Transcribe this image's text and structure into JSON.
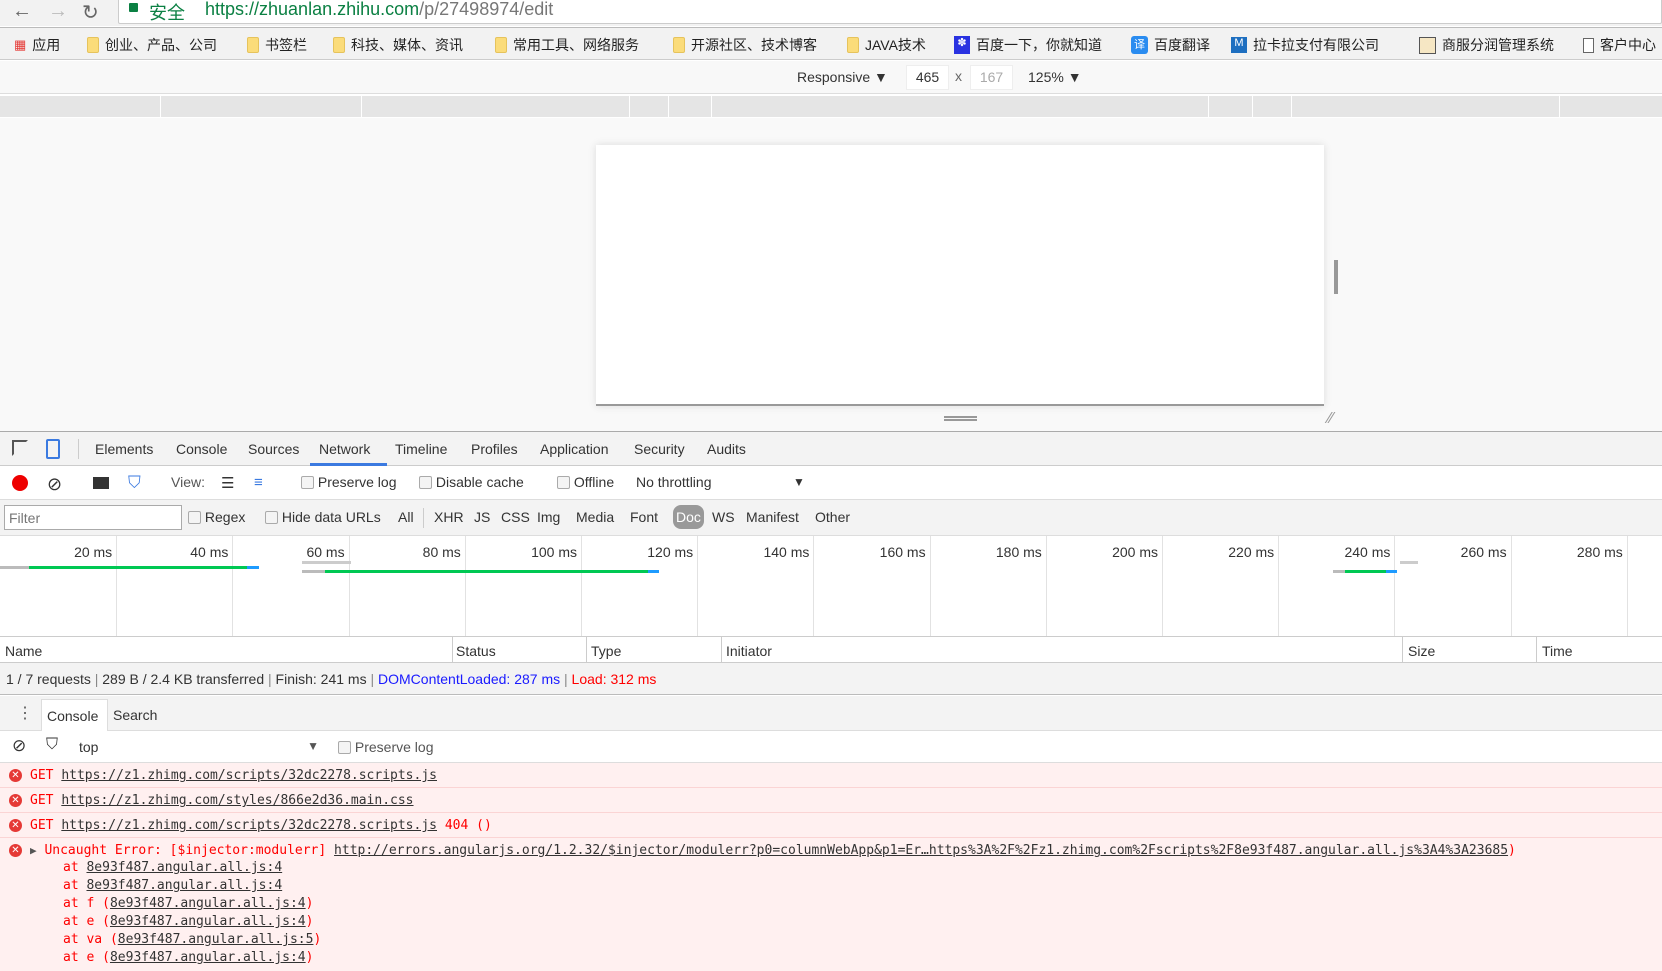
{
  "browser": {
    "security_label": "安全",
    "url_host": "https://zhuanlan.zhihu.com",
    "url_path": "/p/27498974/edit",
    "bookmarks": [
      "应用",
      "创业、产品、公司",
      "书签栏",
      "科技、媒体、资讯",
      "常用工具、网络服务",
      "开源社区、技术博客",
      "JAVA技术",
      "百度一下，你就知道",
      "百度翻译",
      "拉卡拉支付有限公司",
      "商服分润管理系统",
      "客户中心"
    ]
  },
  "device_toolbar": {
    "mode": "Responsive",
    "width": "465",
    "height": "167",
    "zoom": "125%",
    "times": "x"
  },
  "devtools": {
    "tabs": [
      "Elements",
      "Console",
      "Sources",
      "Network",
      "Timeline",
      "Profiles",
      "Application",
      "Security",
      "Audits"
    ],
    "active_tab": "Network",
    "network_toolbar": {
      "view_label": "View:",
      "preserve_log": "Preserve log",
      "disable_cache": "Disable cache",
      "offline": "Offline",
      "throttling": "No throttling"
    },
    "filter": {
      "placeholder": "Filter",
      "regex": "Regex",
      "hide_data_urls": "Hide data URLs",
      "types": [
        "All",
        "XHR",
        "JS",
        "CSS",
        "Img",
        "Media",
        "Font",
        "Doc",
        "WS",
        "Manifest",
        "Other"
      ],
      "active_type": "Doc"
    },
    "columns": [
      "Name",
      "Status",
      "Type",
      "Initiator",
      "Size",
      "Time"
    ],
    "summary": {
      "requests": "1 / 7 requests",
      "transferred": "289 B / 2.4 KB transferred",
      "finish": "Finish: 241 ms",
      "dcl": "DOMContentLoaded: 287 ms",
      "load": "Load: 312 ms",
      "dcl_color": "#1a1aff",
      "load_color": "#f00"
    },
    "drawer": {
      "tabs": [
        "Console",
        "Search"
      ],
      "context": "top",
      "preserve_log": "Preserve log"
    }
  },
  "chart_data": {
    "type": "timeline",
    "tick_labels": [
      "20 ms",
      "40 ms",
      "60 ms",
      "80 ms",
      "100 ms",
      "120 ms",
      "140 ms",
      "160 ms",
      "180 ms",
      "200 ms",
      "220 ms",
      "240 ms",
      "260 ms",
      "280 ms"
    ],
    "ticks_ms": [
      20,
      40,
      60,
      80,
      100,
      120,
      140,
      160,
      180,
      200,
      220,
      240,
      260,
      280
    ],
    "bars": [
      {
        "start": 0,
        "wait_end": 5,
        "download_start": 42.5,
        "end": 44.5
      },
      {
        "start": 52,
        "wait_end": 56,
        "download_start": 111.5,
        "end": 113.5
      },
      {
        "start": 229.5,
        "wait_end": 231.5,
        "download_start": 238.5,
        "end": 240.5
      }
    ],
    "markers": [
      {
        "start": 52,
        "end": 60.5
      },
      {
        "start": 241,
        "end": 244
      }
    ],
    "colors": {
      "waiting": "#00c853",
      "download": "#1e9bff",
      "queue": "#bbbbbb"
    }
  },
  "console": {
    "messages": [
      {
        "method": "GET",
        "url": "https://z1.zhimg.com/scripts/32dc2278.scripts.js",
        "suffix": ""
      },
      {
        "method": "GET",
        "url": "https://z1.zhimg.com/styles/866e2d36.main.css",
        "suffix": ""
      },
      {
        "method": "GET",
        "url": "https://z1.zhimg.com/scripts/32dc2278.scripts.js",
        "suffix": " 404 ()"
      }
    ],
    "error": {
      "text": "Uncaught Error: [$injector:modulerr] ",
      "url": "http://errors.angularjs.org/1.2.32/$injector/modulerr?p0=columnWebApp&p1=Er…https%3A%2F%2Fz1.zhimg.com%2Fscripts%2F8e93f487.angular.all.js%3A4%3A23685",
      "close": ")",
      "stack": [
        {
          "prefix": "at ",
          "fn": "",
          "file": "8e93f487.angular.all.js:4"
        },
        {
          "prefix": "at ",
          "fn": "",
          "file": "8e93f487.angular.all.js:4"
        },
        {
          "prefix": "at ",
          "fn": "f (",
          "file": "8e93f487.angular.all.js:4",
          "close": ")"
        },
        {
          "prefix": "at ",
          "fn": "e (",
          "file": "8e93f487.angular.all.js:4",
          "close": ")"
        },
        {
          "prefix": "at ",
          "fn": "va (",
          "file": "8e93f487.angular.all.js:5",
          "close": ")"
        },
        {
          "prefix": "at ",
          "fn": "e (",
          "file": "8e93f487.angular.all.js:4",
          "close": ")"
        }
      ]
    }
  }
}
